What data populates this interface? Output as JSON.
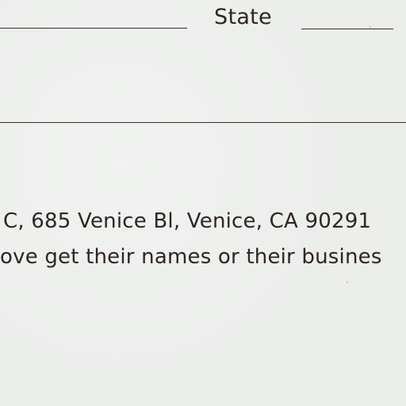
{
  "form": {
    "state_label": "State"
  },
  "footer": {
    "line1": "C, 685 Venice Bl, Venice, CA 90291",
    "line2": "ove get their names or their busines"
  }
}
